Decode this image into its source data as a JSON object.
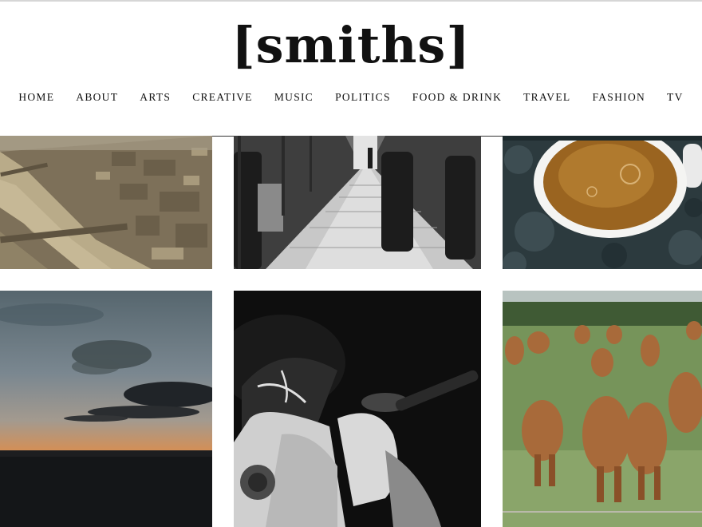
{
  "site": {
    "logo": "[smiths]"
  },
  "nav": {
    "items": [
      {
        "label": "HOME"
      },
      {
        "label": "ABOUT"
      },
      {
        "label": "ARTS"
      },
      {
        "label": "CREATIVE"
      },
      {
        "label": "MUSIC"
      },
      {
        "label": "POLITICS"
      },
      {
        "label": "FOOD & DRINK"
      },
      {
        "label": "TRAVEL"
      },
      {
        "label": "FASHION"
      },
      {
        "label": "TV"
      }
    ]
  },
  "posts": [
    {
      "image": "aerial-city-river-photo"
    },
    {
      "image": "arcade-walkway-bw-photo"
    },
    {
      "image": "tea-cup-photo"
    },
    {
      "image": "sunset-sky-photo"
    },
    {
      "image": "smoker-bw-photo"
    },
    {
      "image": "cows-field-photo"
    }
  ]
}
